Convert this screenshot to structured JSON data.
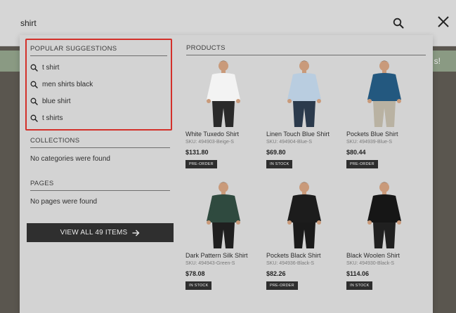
{
  "background": {
    "banner_text": "s!"
  },
  "search": {
    "value": "shirt",
    "search_icon": "search-icon",
    "close_icon": "close-icon"
  },
  "suggestions": {
    "heading": "POPULAR SUGGESTIONS",
    "items": [
      "t shirt",
      "men shirts black",
      "blue shirt",
      "t shirts"
    ]
  },
  "collections": {
    "heading": "COLLECTIONS",
    "empty": "No categories were found"
  },
  "pages": {
    "heading": "PAGES",
    "empty": "No pages were found"
  },
  "view_all": {
    "label": "VIEW ALL 49 ITEMS",
    "icon": "arrow-right-icon"
  },
  "products": {
    "heading": "PRODUCTS",
    "items": [
      {
        "name": "White Tuxedo Shirt",
        "sku": "SKU: 494903-Beige-S",
        "price": "$131.80",
        "badge": "PRE-ORDER",
        "shirt_color": "#f3f3f3",
        "pants_color": "#2a2a2a"
      },
      {
        "name": "Linen Touch Blue Shirt",
        "sku": "SKU: 494904-Blue-S",
        "price": "$69.80",
        "badge": "IN STOCK",
        "shirt_color": "#b9cde0",
        "pants_color": "#2b3a4c"
      },
      {
        "name": "Pockets Blue Shirt",
        "sku": "SKU: 494939-Blue-S",
        "price": "$80.44",
        "badge": "PRE-ORDER",
        "shirt_color": "#23587f",
        "pants_color": "#b9b2a2"
      },
      {
        "name": "Dark Pattern Silk Shirt",
        "sku": "SKU: 494943-Green-S",
        "price": "$78.08",
        "badge": "IN STOCK",
        "shirt_color": "#2f4a3f",
        "pants_color": "#1f1f1f"
      },
      {
        "name": "Pockets Black Shirt",
        "sku": "SKU: 494936-Black-S",
        "price": "$82.26",
        "badge": "PRE-ORDER",
        "shirt_color": "#1c1c1c",
        "pants_color": "#1a1a1a"
      },
      {
        "name": "Black Woolen Shirt",
        "sku": "SKU: 494930-Black-S",
        "price": "$114.06",
        "badge": "IN STOCK",
        "shirt_color": "#161616",
        "pants_color": "#202020"
      }
    ]
  }
}
